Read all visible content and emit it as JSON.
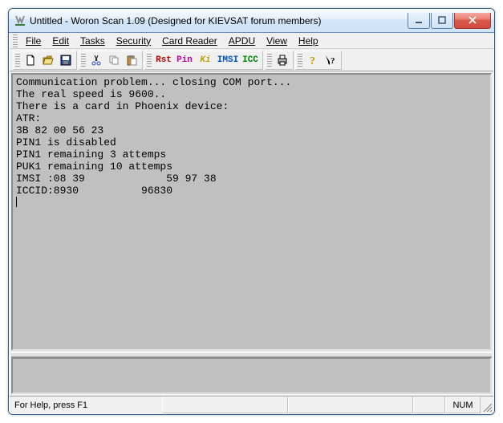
{
  "title": "Untitled - Woron Scan 1.09 (Designed for KIEVSAT forum members)",
  "menu": {
    "file": "File",
    "edit": "Edit",
    "tasks": "Tasks",
    "security": "Security",
    "cardreader": "Card Reader",
    "apdu": "APDU",
    "view": "View",
    "help": "Help"
  },
  "toolbar_text": {
    "rst": "Rst",
    "pin": "Pin",
    "ki": "Ki",
    "imsi": "IMSI",
    "icc": "ICC"
  },
  "console_lines": [
    "Communication problem... closing COM port...",
    "The real speed is 9600..",
    "There is a card in Phoenix device:",
    "ATR:",
    "3B 82 00 56 23",
    "PIN1 is disabled",
    "PIN1 remaining 3 attemps",
    "PUK1 remaining 10 attemps",
    "IMSI :08 39             59 97 38",
    "ICCID:8930          96830"
  ],
  "status": {
    "help": "For Help, press F1",
    "num": "NUM"
  }
}
